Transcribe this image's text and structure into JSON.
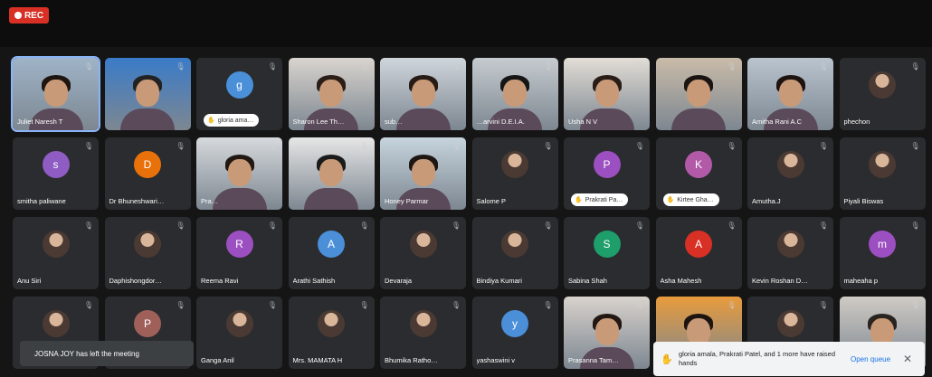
{
  "recording": {
    "label": "REC"
  },
  "tiles": [
    {
      "name": "Juliet Naresh T",
      "type": "video",
      "active": true,
      "hair": "#1f1510",
      "bg": "#9fb4c8"
    },
    {
      "name": "",
      "type": "video",
      "bg": "#3a7bc8",
      "hair": "#222"
    },
    {
      "name": "gloria ama…",
      "type": "avatar",
      "letter": "g",
      "color": "#4a90d9",
      "chip": "gloria ama…"
    },
    {
      "name": "Sharon Lee Th…",
      "type": "video",
      "bg": "#d9d4ce",
      "hair": "#2b1d18"
    },
    {
      "name": "sub…",
      "type": "video",
      "bg": "#cfd5db",
      "hair": "#281b16"
    },
    {
      "name": "…arvini D.E.I.A.",
      "type": "video",
      "bg": "#c6cbcf",
      "hair": "#151515"
    },
    {
      "name": "Usha N V",
      "type": "video",
      "bg": "#e2ddd6",
      "hair": "#2a1d17"
    },
    {
      "name": "",
      "type": "video",
      "bg": "#c9bba8",
      "hair": "#1a1512"
    },
    {
      "name": "Amitha Rani A.C",
      "type": "video",
      "bg": "#b9c4cf",
      "hair": "#1d1410"
    },
    {
      "name": "phechon",
      "type": "photo"
    },
    {
      "name": "smitha paliwane",
      "type": "avatar",
      "letter": "s",
      "color": "#8e5cc2"
    },
    {
      "name": "Dr Bhuneshwari…",
      "type": "avatar",
      "letter": "D",
      "color": "#e8710a"
    },
    {
      "name": "Pra…",
      "type": "video",
      "bg": "#d6d9dc",
      "hair": "#221812"
    },
    {
      "name": "",
      "type": "video",
      "bg": "#e6e6e6",
      "hair": "#1b1b1b"
    },
    {
      "name": "Honey Parmar",
      "type": "video",
      "bg": "#c6d4de",
      "hair": "#1e1612"
    },
    {
      "name": "Salome P",
      "type": "photo"
    },
    {
      "name": "Prakrati Pa…",
      "type": "avatar",
      "letter": "P",
      "color": "#9c4fc1",
      "chip": "Prakrati Pa…"
    },
    {
      "name": "Kirtee Gha…",
      "type": "avatar",
      "letter": "K",
      "color": "#b25aa8",
      "chip": "Kirtee Gha…"
    },
    {
      "name": "Amutha.J",
      "type": "photo"
    },
    {
      "name": "Piyali Biswas",
      "type": "photo"
    },
    {
      "name": "Anu Siri",
      "type": "photo"
    },
    {
      "name": "Daphishongdor…",
      "type": "photo"
    },
    {
      "name": "Reema Ravi",
      "type": "avatar",
      "letter": "R",
      "color": "#9c4fc1"
    },
    {
      "name": "Arathi Sathish",
      "type": "avatar",
      "letter": "A",
      "color": "#4a8fd8"
    },
    {
      "name": "Devaraja",
      "type": "photo"
    },
    {
      "name": "Bindiya Kumari",
      "type": "photo"
    },
    {
      "name": "Sabina Shah",
      "type": "avatar",
      "letter": "S",
      "color": "#1e9e6a"
    },
    {
      "name": "Asha Mahesh",
      "type": "avatar",
      "letter": "A",
      "color": "#d93025"
    },
    {
      "name": "Kevin Roshan D…",
      "type": "photo"
    },
    {
      "name": "maheaha p",
      "type": "avatar",
      "letter": "m",
      "color": "#9c4fc1"
    },
    {
      "name": "",
      "type": "photo"
    },
    {
      "name": "",
      "type": "avatar",
      "letter": "P",
      "color": "#a0605a"
    },
    {
      "name": "Ganga Anil",
      "type": "photo"
    },
    {
      "name": "Mrs. MAMATA H",
      "type": "photo"
    },
    {
      "name": "Bhumika Ratho…",
      "type": "photo"
    },
    {
      "name": "yashaswini v",
      "type": "avatar",
      "letter": "y",
      "color": "#4a8fd8"
    },
    {
      "name": "Prasanna Tam…",
      "type": "video",
      "bg": "#d8d2cc",
      "hair": "#221712"
    },
    {
      "name": "",
      "type": "video",
      "bg": "#e89b3c",
      "hair": "#1d1410"
    },
    {
      "name": "",
      "type": "photo"
    },
    {
      "name": "",
      "type": "video",
      "bg": "#cfcac4",
      "hair": "#2a2420"
    }
  ],
  "notifications": {
    "left_toast": "JOSNA JOY has left the meeting",
    "raised_hands_message": "gloria amala, Prakrati Patel, and 1 more have raised hands",
    "open_queue_label": "Open queue",
    "close_label": "✕"
  }
}
